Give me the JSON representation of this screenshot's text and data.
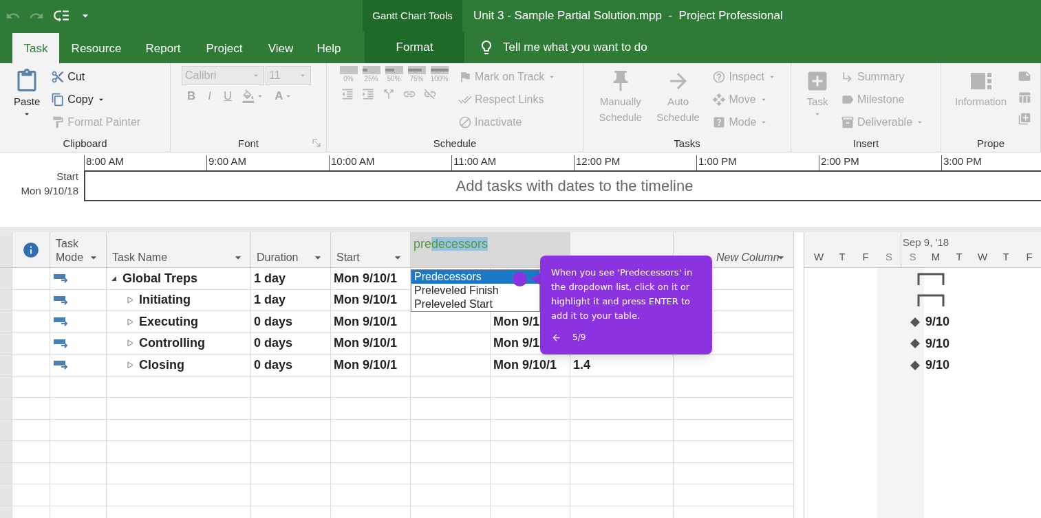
{
  "window": {
    "title": "Unit 3 - Sample Partial Solution.mpp  -  Project Professional",
    "context_group": "Gantt Chart Tools"
  },
  "tabs": [
    {
      "label": "Task",
      "selected": true,
      "kind": "normal"
    },
    {
      "label": "Resource",
      "selected": false,
      "kind": "normal"
    },
    {
      "label": "Report",
      "selected": false,
      "kind": "normal"
    },
    {
      "label": "Project",
      "selected": false,
      "kind": "normal"
    },
    {
      "label": "View",
      "selected": false,
      "kind": "normal"
    },
    {
      "label": "Help",
      "selected": false,
      "kind": "normal"
    },
    {
      "label": "Format",
      "selected": false,
      "kind": "contextual"
    }
  ],
  "tell_me": "Tell me what you want to do",
  "ribbon": [
    {
      "label": "Clipboard",
      "launcher": false,
      "columns": [
        [
          [
            {
              "kind": "large",
              "label": "Paste",
              "disabled": false,
              "menu": true
            }
          ]
        ],
        [
          [
            {
              "kind": "small",
              "label": "Cut",
              "disabled": false,
              "menu": false
            }
          ],
          [
            {
              "kind": "small",
              "label": "Copy",
              "disabled": false,
              "menu": true
            }
          ],
          [
            {
              "kind": "small",
              "label": "Format Painter",
              "disabled": true,
              "menu": false
            }
          ]
        ]
      ]
    },
    {
      "label": "Font",
      "launcher": true,
      "columns": [
        [
          [
            {
              "kind": "combo",
              "label": "Calibri",
              "disabled": true,
              "menu": true
            },
            {
              "kind": "combo",
              "label": "11",
              "disabled": true,
              "menu": true
            }
          ],
          [
            {
              "kind": "glyph",
              "label": "B",
              "disabled": true,
              "menu": false
            },
            {
              "kind": "glyph",
              "label": "I",
              "disabled": true,
              "menu": false
            },
            {
              "kind": "glyph",
              "label": "U",
              "disabled": true,
              "menu": false
            },
            {
              "kind": "icon",
              "disabled": true,
              "menu": true
            },
            {
              "kind": "glyph",
              "label": "A",
              "disabled": true,
              "menu": true
            }
          ]
        ]
      ]
    },
    {
      "label": "Schedule",
      "launcher": false,
      "columns": [
        [
          [
            {
              "kind": "percent",
              "label": "0%",
              "disabled": true
            },
            {
              "kind": "percent",
              "label": "25%",
              "disabled": true
            },
            {
              "kind": "percent",
              "label": "50%",
              "disabled": true
            },
            {
              "kind": "percent",
              "label": "75%",
              "disabled": true
            },
            {
              "kind": "percent",
              "label": "100%",
              "disabled": true
            }
          ],
          [
            {
              "kind": "icon",
              "disabled": true,
              "menu": false
            },
            {
              "kind": "icon",
              "disabled": true,
              "menu": false
            },
            {
              "kind": "icon",
              "disabled": true,
              "menu": false
            },
            {
              "kind": "icon",
              "disabled": true,
              "menu": false
            },
            {
              "kind": "icon",
              "disabled": true,
              "menu": false
            }
          ]
        ],
        [
          [
            {
              "kind": "small",
              "label": "Mark on Track",
              "disabled": true,
              "menu": true
            }
          ],
          [
            {
              "kind": "small",
              "label": "Respect Links",
              "disabled": true,
              "menu": false
            }
          ],
          [
            {
              "kind": "small",
              "label": "Inactivate",
              "disabled": true,
              "menu": false
            }
          ]
        ]
      ]
    },
    {
      "label": "Tasks",
      "launcher": false,
      "columns": [
        [
          [
            {
              "kind": "large",
              "label": "Manually Schedule",
              "disabled": true,
              "menu": false
            }
          ]
        ],
        [
          [
            {
              "kind": "large",
              "label": "Auto Schedule",
              "disabled": true,
              "menu": false
            }
          ]
        ],
        [
          [
            {
              "kind": "small",
              "label": "Inspect",
              "disabled": true,
              "menu": true
            }
          ],
          [
            {
              "kind": "small",
              "label": "Move",
              "disabled": true,
              "menu": true
            }
          ],
          [
            {
              "kind": "small",
              "label": "Mode",
              "disabled": true,
              "menu": true
            }
          ]
        ]
      ]
    },
    {
      "label": "Insert",
      "launcher": false,
      "columns": [
        [
          [
            {
              "kind": "large",
              "label": "Task",
              "disabled": true,
              "menu": true
            }
          ]
        ],
        [
          [
            {
              "kind": "small",
              "label": "Summary",
              "disabled": true,
              "menu": false
            }
          ],
          [
            {
              "kind": "small",
              "label": "Milestone",
              "disabled": true,
              "menu": false
            }
          ],
          [
            {
              "kind": "small",
              "label": "Deliverable",
              "disabled": true,
              "menu": true
            }
          ]
        ]
      ]
    },
    {
      "label": "Prope",
      "launcher": false,
      "columns": [
        [
          [
            {
              "kind": "large",
              "label": "Information",
              "disabled": true,
              "menu": false
            }
          ]
        ],
        [
          [
            {
              "kind": "icon",
              "disabled": true,
              "menu": false
            }
          ],
          [
            {
              "kind": "icon",
              "disabled": true,
              "menu": false
            }
          ],
          [
            {
              "kind": "icon",
              "disabled": true,
              "menu": false
            }
          ]
        ]
      ]
    }
  ],
  "timeline": {
    "start_label": "Start",
    "start_date": "Mon 9/10/18",
    "ticks": [
      "8:00 AM",
      "9:00 AM",
      "10:00 AM",
      "11:00 AM",
      "12:00 PM",
      "1:00 PM",
      "2:00 PM",
      "3:00 PM"
    ],
    "message": "Add tasks with dates to the timeline"
  },
  "table": {
    "columns": [
      {
        "kind": "info"
      },
      {
        "kind": "text",
        "label": "Task Mode",
        "filter": true
      },
      {
        "kind": "text",
        "label": "Task Name",
        "filter": true
      },
      {
        "kind": "text",
        "label": "Duration",
        "filter": true
      },
      {
        "kind": "text",
        "label": "Start",
        "filter": true
      },
      {
        "kind": "entry",
        "typed": "pre",
        "completion": "decessors"
      },
      {
        "kind": "covered"
      },
      {
        "kind": "add",
        "label": "New Column",
        "filter": true
      }
    ],
    "rows": [
      {
        "name": "Global Treps",
        "expanded": true,
        "duration": "1 day",
        "start": "Mon 9/10/1",
        "bar": {
          "kind": "summary"
        },
        "children": [
          {
            "name": "Initiating",
            "expanded": false,
            "duration": "1 day",
            "start": "Mon 9/10/1",
            "bar": {
              "kind": "summary"
            }
          },
          {
            "name": "Executing",
            "expanded": false,
            "duration": "0 days",
            "start": "Mon 9/10/1",
            "finish": "Mon 9/1",
            "bar": {
              "kind": "milestone",
              "label": "9/10"
            }
          },
          {
            "name": "Controlling",
            "expanded": false,
            "duration": "0 days",
            "start": "Mon 9/10/1",
            "finish": "Mon 9/1",
            "bar": {
              "kind": "milestone",
              "label": "9/10"
            }
          },
          {
            "name": "Closing",
            "expanded": false,
            "duration": "0 days",
            "start": "Mon 9/10/1",
            "finish": "Mon 9/10/1",
            "wbs": "1.4",
            "bar": {
              "kind": "milestone",
              "label": "9/10"
            }
          }
        ]
      }
    ]
  },
  "dropdown": {
    "options": [
      {
        "label": "Predecessors",
        "selected": true
      },
      {
        "label": "Preleveled Finish",
        "selected": false
      },
      {
        "label": "Preleveled Start",
        "selected": false
      }
    ]
  },
  "gantt": {
    "week_label": "Sep 9, '18",
    "days": [
      {
        "label": "W",
        "weekend": false,
        "week_start": false
      },
      {
        "label": "T",
        "weekend": false,
        "week_start": false
      },
      {
        "label": "F",
        "weekend": false,
        "week_start": false
      },
      {
        "label": "S",
        "weekend": true,
        "week_start": false
      },
      {
        "label": "S",
        "weekend": true,
        "week_start": true
      },
      {
        "label": "M",
        "weekend": false,
        "week_start": false
      },
      {
        "label": "T",
        "weekend": false,
        "week_start": false
      },
      {
        "label": "W",
        "weekend": false,
        "week_start": false
      },
      {
        "label": "T",
        "weekend": false,
        "week_start": false
      },
      {
        "label": "F",
        "weekend": false,
        "week_start": false
      }
    ]
  },
  "tooltip": {
    "text": "When you see 'Predecessors' in the dropdown list, click on it or highlight it and press ENTER to add it to your table.",
    "step": "5/9"
  }
}
